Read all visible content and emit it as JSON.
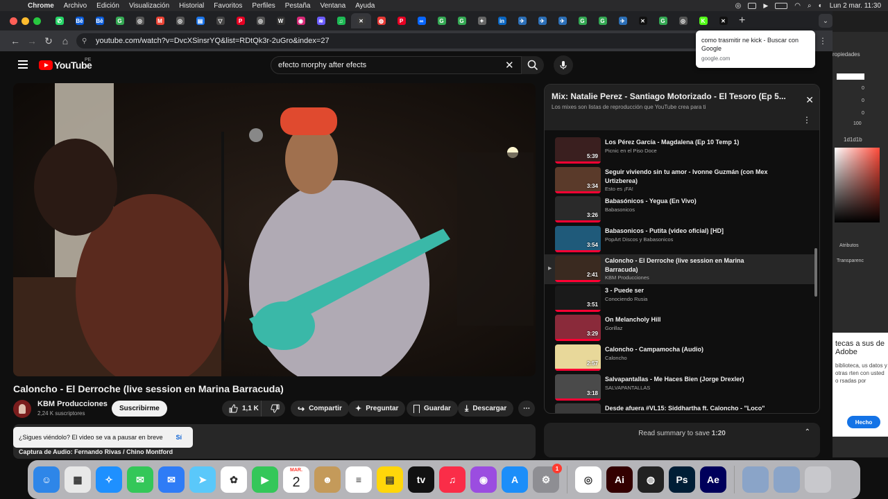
{
  "menubar": {
    "app": "Chrome",
    "items": [
      "Archivo",
      "Edición",
      "Visualización",
      "Historial",
      "Favoritos",
      "Perfiles",
      "Pestaña",
      "Ventana",
      "Ayuda"
    ],
    "clock": "Lun 2 mar.  11:30"
  },
  "tabs": {
    "favicons": [
      {
        "color": "#25d366",
        "glyph": "✆"
      },
      {
        "color": "#0a5bd8",
        "glyph": "Bē"
      },
      {
        "color": "#0a5bd8",
        "glyph": "Bē"
      },
      {
        "color": "#34a853",
        "glyph": "G"
      },
      {
        "color": "#555555",
        "glyph": "◎"
      },
      {
        "color": "#ea4335",
        "glyph": "M"
      },
      {
        "color": "#555555",
        "glyph": "◎"
      },
      {
        "color": "#1a73e8",
        "glyph": "▤"
      },
      {
        "color": "#444444",
        "glyph": "▽"
      },
      {
        "color": "#e60023",
        "glyph": "P"
      },
      {
        "color": "#555555",
        "glyph": "◎"
      },
      {
        "color": "#333333",
        "glyph": "W"
      },
      {
        "color": "#d62976",
        "glyph": "◉"
      },
      {
        "color": "#6b5cff",
        "glyph": "≋"
      },
      {
        "color": "#1db954",
        "glyph": "♫"
      },
      {
        "color": "#3a3a3a",
        "glyph": "✕"
      },
      {
        "color": "#e53935",
        "glyph": "◍"
      },
      {
        "color": "#e60023",
        "glyph": "P"
      },
      {
        "color": "#0866ff",
        "glyph": "∞"
      },
      {
        "color": "#34a853",
        "glyph": "G"
      },
      {
        "color": "#34a853",
        "glyph": "G"
      },
      {
        "color": "#666666",
        "glyph": "✦"
      },
      {
        "color": "#0a66c2",
        "glyph": "in"
      },
      {
        "color": "#2c6fb7",
        "glyph": "✈"
      },
      {
        "color": "#2c6fb7",
        "glyph": "✈"
      },
      {
        "color": "#2c6fb7",
        "glyph": "✈"
      },
      {
        "color": "#34a853",
        "glyph": "G"
      },
      {
        "color": "#34a853",
        "glyph": "G"
      },
      {
        "color": "#2c6fb7",
        "glyph": "✈"
      },
      {
        "color": "#111111",
        "glyph": "✕"
      },
      {
        "color": "#34a853",
        "glyph": "G"
      },
      {
        "color": "#555555",
        "glyph": "◎"
      },
      {
        "color": "#53fc18",
        "glyph": "K"
      },
      {
        "color": "#111111",
        "glyph": "✕"
      }
    ],
    "active_index": 15
  },
  "address_bar": {
    "url": "youtube.com/watch?v=DvcXSinsrYQ&list=RDtQk3r-2uGro&index=27"
  },
  "tooltip": {
    "title": "como trasmitir ne kick - Buscar con Google",
    "domain": "google.com"
  },
  "youtube": {
    "logo_text": "YouTube",
    "country": "PE",
    "search_value": "efecto morphy after efects"
  },
  "video": {
    "title": "Caloncho - El Derroche (live session en Marina Barracuda)",
    "channel": "KBM Producciones",
    "subscribers": "2,24 K suscriptores",
    "subscribe_label": "Suscribirme",
    "likes": "1,1 K",
    "share_label": "Compartir",
    "ask_label": "Preguntar",
    "save_label": "Guardar",
    "download_label": "Descargar",
    "description": "Captura de Audio: Fernando Rivas / Chino Montford"
  },
  "toast": {
    "message": "¿Sigues viéndolo? El video se va a pausar en breve",
    "action": "Sí"
  },
  "playlist": {
    "title": "Mix: Natalie Perez - Santiago Motorizado - El Tesoro (Ep 5...",
    "subtitle": "Los mixes son listas de reproducción que YouTube crea para ti",
    "items": [
      {
        "title": "Los Pérez García - Magdalena (Ep 10 Temp 1)",
        "channel": "Picnic en el Piso Doce",
        "duration": "5:39",
        "color": "#3a1f1f"
      },
      {
        "title": "Seguir viviendo sin tu amor - Ivonne Guzmán (con Mex Urtizberea)",
        "channel": "Esto es ¡FA!",
        "duration": "3:34",
        "color": "#5a3a2a"
      },
      {
        "title": "Babasónicos - Yegua (En Vivo)",
        "channel": "Babasonicos",
        "duration": "3:26",
        "color": "#2a2a2a"
      },
      {
        "title": "Babasonicos - Putita (video oficial) [HD]",
        "channel": "PopArt Discos y Babasonicos",
        "duration": "3:54",
        "color": "#1f5a7a"
      },
      {
        "title": "Caloncho - El Derroche (live session en Marina Barracuda)",
        "channel": "KBM Producciones",
        "duration": "2:41",
        "color": "#3a2a20"
      },
      {
        "title": "3 - Puede ser",
        "channel": "Conociendo Rusia",
        "duration": "3:51",
        "color": "#1a1a1a"
      },
      {
        "title": "On Melancholy Hill",
        "channel": "Gorillaz",
        "duration": "3:29",
        "color": "#8a2a3a"
      },
      {
        "title": "Caloncho - Campamocha (Audio)",
        "channel": "Caloncho",
        "duration": "2:57",
        "color": "#e8d89a"
      },
      {
        "title": "Salvapantallas - Me Haces Bien (Jorge Drexler)",
        "channel": "SALVAPANTALLAS",
        "duration": "3:18",
        "color": "#4a4a4a"
      },
      {
        "title": "Desde afuera #VL15: Siddhartha ft. Caloncho - \"Loco\"",
        "channel": "",
        "duration": "",
        "color": "#3a3a3a"
      }
    ],
    "current_index": 4
  },
  "summary": {
    "label": "Read summary to save",
    "time": "1:20"
  },
  "adobe_popup": {
    "heading": "tecas a sus de Adobe",
    "body": "biblioteca, us datos y otras rten con usted o rsadas por",
    "button": "Hecho"
  },
  "photoshop_panel": {
    "tab1": "ropiedades",
    "tab2": "Atributos",
    "transparency": "Transparenc",
    "hex": "1d1d1b",
    "value100": "100",
    "value0": "0"
  },
  "dock": {
    "calendar_month": "MAR.",
    "calendar_day": "2",
    "settings_badge": "1",
    "apps": [
      {
        "name": "finder",
        "color": "#2e86e8",
        "glyph": "☺"
      },
      {
        "name": "launchpad",
        "color": "#e8e8e8",
        "glyph": "▦"
      },
      {
        "name": "safari",
        "color": "#1e90ff",
        "glyph": "✧"
      },
      {
        "name": "messages",
        "color": "#34c759",
        "glyph": "✉"
      },
      {
        "name": "mail",
        "color": "#2f7cf6",
        "glyph": "✉"
      },
      {
        "name": "maps",
        "color": "#5ac8fa",
        "glyph": "➤"
      },
      {
        "name": "photos",
        "color": "#ffffff",
        "glyph": "✿"
      },
      {
        "name": "facetime",
        "color": "#34c759",
        "glyph": "▶"
      },
      {
        "name": "calendar",
        "color": "#ffffff",
        "glyph": "2"
      },
      {
        "name": "contacts",
        "color": "#c49a5a",
        "glyph": "☻"
      },
      {
        "name": "reminders",
        "color": "#ffffff",
        "glyph": "≡"
      },
      {
        "name": "notes",
        "color": "#ffd60a",
        "glyph": "▤"
      },
      {
        "name": "tv",
        "color": "#111111",
        "glyph": "tv"
      },
      {
        "name": "music",
        "color": "#fa2d48",
        "glyph": "♫"
      },
      {
        "name": "podcasts",
        "color": "#9b4de0",
        "glyph": "◉"
      },
      {
        "name": "app-store",
        "color": "#1c8ef9",
        "glyph": "A"
      },
      {
        "name": "system-settings",
        "color": "#8e8e93",
        "glyph": "⚙"
      },
      {
        "name": "chrome",
        "color": "#ffffff",
        "glyph": "◎"
      },
      {
        "name": "illustrator",
        "color": "#330000",
        "glyph": "Ai"
      },
      {
        "name": "obs",
        "color": "#222222",
        "glyph": "◍"
      },
      {
        "name": "photoshop",
        "color": "#001e36",
        "glyph": "Ps"
      },
      {
        "name": "after-effects",
        "color": "#00005b",
        "glyph": "Ae"
      }
    ]
  }
}
